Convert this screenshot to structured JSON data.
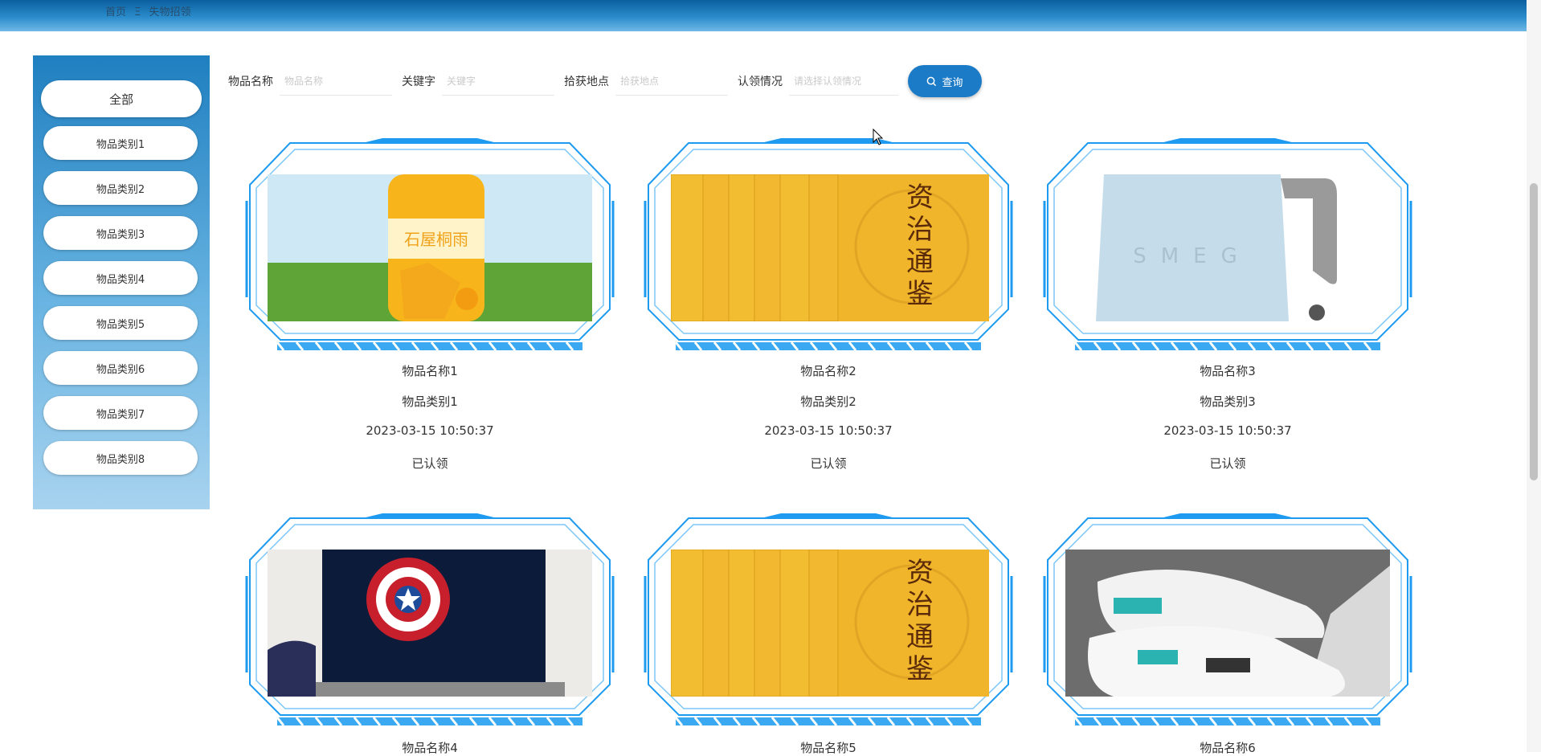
{
  "breadcrumb": {
    "home": "首页",
    "sep": "Ξ",
    "current": "失物招领"
  },
  "sidebar": {
    "all_label": "全部",
    "items": [
      "物品类别1",
      "物品类别2",
      "物品类别3",
      "物品类别4",
      "物品类别5",
      "物品类别6",
      "物品类别7",
      "物品类别8"
    ]
  },
  "search": {
    "name_label": "物品名称",
    "name_placeholder": "物品名称",
    "keyword_label": "关键字",
    "keyword_placeholder": "关键字",
    "location_label": "拾获地点",
    "location_placeholder": "拾获地点",
    "claim_label": "认领情况",
    "claim_placeholder": "请选择认领情况",
    "button_label": "查询"
  },
  "items": [
    {
      "name": "物品名称1",
      "category": "物品类别1",
      "time": "2023-03-15 10:50:37",
      "status": "已认领",
      "image": "juice-bottle"
    },
    {
      "name": "物品名称2",
      "category": "物品类别2",
      "time": "2023-03-15 10:50:37",
      "status": "已认领",
      "image": "book-set"
    },
    {
      "name": "物品名称3",
      "category": "物品类别3",
      "time": "2023-03-15 10:50:37",
      "status": "已认领",
      "image": "kettle"
    },
    {
      "name": "物品名称4",
      "image": "shield-tv"
    },
    {
      "name": "物品名称5",
      "image": "book-set"
    },
    {
      "name": "物品名称6",
      "image": "sneakers"
    }
  ],
  "book_title": "资治通鉴",
  "kettle_brand": "SMEG",
  "colors": {
    "accent": "#1c7bc6",
    "topbar": "#2a8ccc",
    "frame": "#1e9bf0"
  }
}
